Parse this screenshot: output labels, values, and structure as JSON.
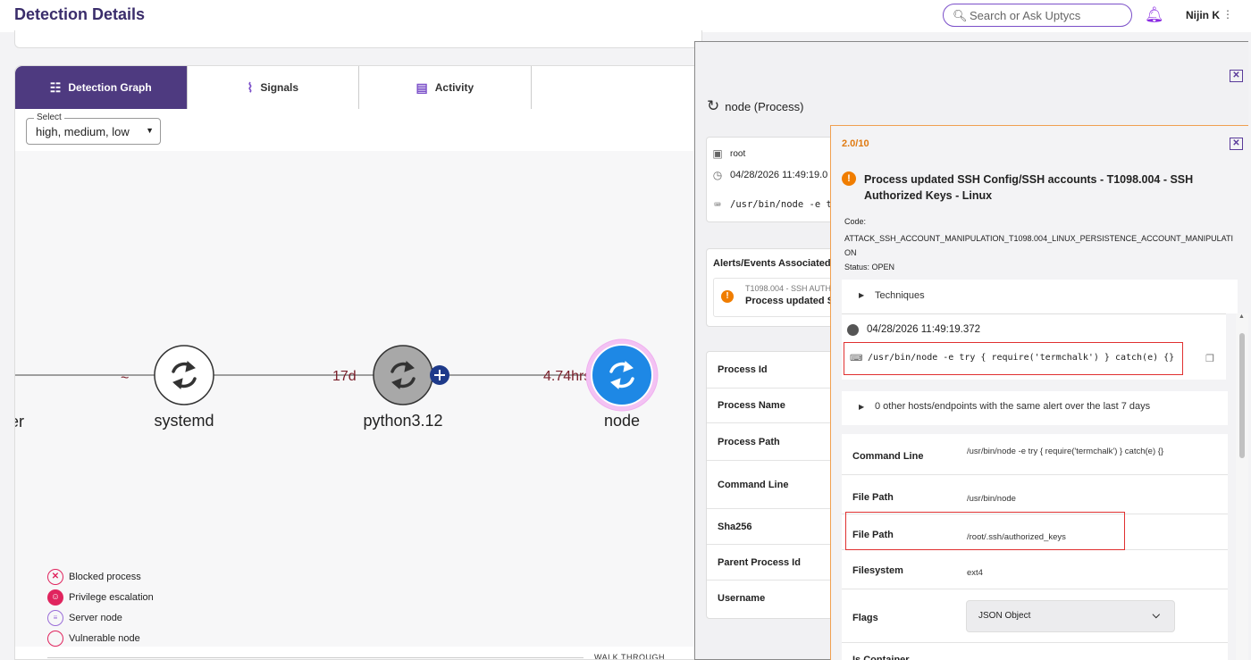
{
  "header": {
    "title": "Detection Details",
    "search_placeholder": "Search or Ask Uptycs",
    "user_name": "Nijin K"
  },
  "tabs": [
    {
      "label": "Detection Graph",
      "active": true
    },
    {
      "label": "Signals",
      "active": false
    },
    {
      "label": "Activity",
      "active": false
    }
  ],
  "filter": {
    "label": "Select",
    "value": "high, medium, low"
  },
  "graph": {
    "nodes": [
      {
        "label": "er"
      },
      {
        "label": "systemd"
      },
      {
        "label": "python3.12"
      },
      {
        "label": "node"
      }
    ],
    "edges": [
      {
        "label": "~"
      },
      {
        "label": "17d"
      },
      {
        "label": "4.74hrs"
      }
    ]
  },
  "legend": [
    {
      "label": "Blocked process"
    },
    {
      "label": "Privilege escalation"
    },
    {
      "label": "Server node"
    },
    {
      "label": "Vulnerable node"
    }
  ],
  "walk_through": "WALK THROUGH",
  "drawer": {
    "title": "node (Process)",
    "user": "root",
    "timestamp": "04/28/2026 11:49:19.0",
    "cmd_preview": "/usr/bin/node -e try",
    "alerts_title": "Alerts/Events Associated",
    "alert_sub": "T1098.004 - SSH AUTH",
    "alert_main": "Process updated SS",
    "properties": [
      "Process Id",
      "Process Name",
      "Process Path",
      "Command Line",
      "Sha256",
      "Parent Process Id",
      "Username"
    ]
  },
  "alert": {
    "count": "2.0/10",
    "title": "Process updated SSH Config/SSH accounts - T1098.004 - SSH Authorized Keys - Linux",
    "code_label": "Code:",
    "code": "ATTACK_SSH_ACCOUNT_MANIPULATION_T1098.004_LINUX_PERSISTENCE_ACCOUNT_MANIPULATION",
    "status": "Status: OPEN",
    "techniques_label": "Techniques",
    "timestamp": "04/28/2026 11:49:19.372",
    "command": "/usr/bin/node -e try { require('termchalk') } catch(e) {}",
    "hosts_label": "0 other hosts/endpoints with the same alert over the last 7 days",
    "details": [
      {
        "key": "Command Line",
        "value": "/usr/bin/node -e try { require('termchalk') } catch(e) {}"
      },
      {
        "key": "File Path",
        "value": "/usr/bin/node"
      },
      {
        "key": "File Path",
        "value": "/root/.ssh/authorized_keys"
      },
      {
        "key": "Filesystem",
        "value": "ext4"
      },
      {
        "key": "Flags",
        "value": "JSON Object"
      },
      {
        "key": "Is Container",
        "value": ""
      }
    ]
  },
  "colors": {
    "brand": "#4e3a80",
    "accent": "#7b4fc9",
    "node_active": "#1e88e5",
    "warning": "#f07d00",
    "highlight_box": "#e03030"
  }
}
